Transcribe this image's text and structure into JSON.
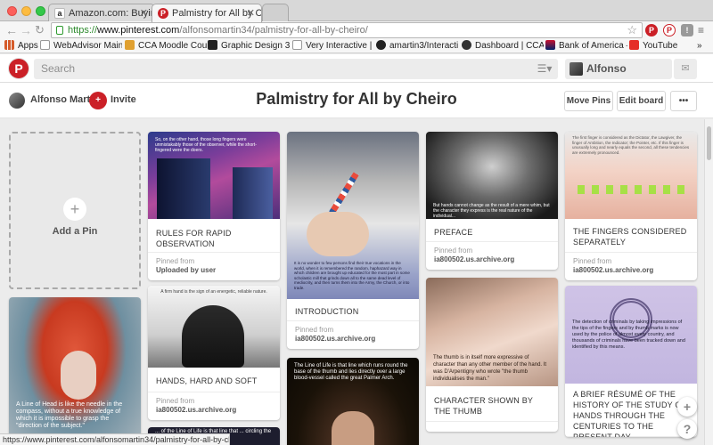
{
  "browser": {
    "tabs": [
      {
        "title": "Amazon.com: Buying Cho",
        "favicon": "a",
        "color": "#222222",
        "active": false
      },
      {
        "title": "Palmistry for All by Cheiro",
        "favicon": "P",
        "color": "#cb2027",
        "active": true
      }
    ],
    "url_scheme": "https://",
    "url_host": "www.pinterest.com",
    "url_path": "/alfonsomartin34/palmistry-for-all-by-cheiro/",
    "bookmarks": [
      {
        "label": "Apps",
        "icon": "apps-grid-icon",
        "color": "#d55c2b"
      },
      {
        "label": "WebAdvisor Main Me",
        "icon": "document-icon",
        "color": "#9a9a9a"
      },
      {
        "label": "CCA Moodle Courses",
        "icon": "moodle-icon",
        "color": "#e0a030"
      },
      {
        "label": "Graphic Design 3: In",
        "icon": "v-logo-icon",
        "color": "#222222"
      },
      {
        "label": "Very Interactive | Hou",
        "icon": "document-icon",
        "color": "#9a9a9a"
      },
      {
        "label": "amartin3/Interactive",
        "icon": "github-icon",
        "color": "#222222"
      },
      {
        "label": "Dashboard | CCA Va",
        "icon": "dashboard-icon",
        "color": "#333333"
      },
      {
        "label": "Bank of America —",
        "icon": "bank-icon",
        "color": "#c8102e"
      },
      {
        "label": "YouTube",
        "icon": "youtube-icon",
        "color": "#e52d27"
      }
    ]
  },
  "header": {
    "search_placeholder": "Search",
    "user_name": "Alfonso"
  },
  "board": {
    "owner": "Alfonso Martin",
    "invite_label": "Invite",
    "title": "Palmistry for All by Cheiro",
    "move_pins": "Move Pins",
    "edit_board": "Edit board",
    "more": "•••"
  },
  "add_pin_label": "Add a Pin",
  "pins": [
    {
      "id": "rules",
      "title": "RULES FOR RAPID OBSERVATION",
      "pinned_from": "Pinned from",
      "source": "Uploaded by user",
      "caption": "So, on the other hand, those long fingers were unmistakably those of the observer, while the short-fingered were the doers."
    },
    {
      "id": "introduction",
      "title": "INTRODUCTION",
      "pinned_from": "Pinned from",
      "source": "ia800502.us.archive.org",
      "caption": "It is no wonder to few persons find their true vocations in the world, when it is remembered the random, haphazard way in which children are brought up educated for the most part in some scholastic mill that grinds down all to the same dead level of mediocrity, and then turns them into the Army, the Church, or into trade."
    },
    {
      "id": "preface",
      "title": "PREFACE",
      "pinned_from": "Pinned from",
      "source": "ia800502.us.archive.org",
      "caption": "But hands cannot change as the result of a mere whim, but the character they express is the real nature of the individual..."
    },
    {
      "id": "fingers",
      "title": "THE FINGERS CONSIDERED SEPARATELY",
      "pinned_from": "Pinned from",
      "source": "ia800502.us.archive.org",
      "caption": "The first finger is considered as the Dictator, the Lawgiver, the finger of Ambition, the Indicator; the Pointer, etc. If this finger is unusually long and nearly equals the second, all these tendencies are extremely pronounced."
    },
    {
      "id": "head",
      "title": "",
      "caption": "A Line of Head is like the needle in the compass, without a true knowledge of which it is impossible to grasp the \"direction of the subject.\""
    },
    {
      "id": "handshard",
      "title": "HANDS, HARD AND SOFT",
      "pinned_from": "Pinned from",
      "source": "ia800502.us.archive.org",
      "caption": "A firm hand is the sign of an energetic, reliable nature."
    },
    {
      "id": "lifeline",
      "title": "",
      "caption": "The Line of Life is that line which runs round the base of the thumb and lies directly over a large blood-vessel called the great Palmer Arch."
    },
    {
      "id": "thumb",
      "title": "CHARACTER SHOWN BY THE THUMB",
      "caption": "The thumb is in itself more expressive of character than any other member of the hand. It was D'Arpentigny who wrote \"the thumb individualises the man.\""
    },
    {
      "id": "history",
      "title": "A BRIEF RÉSUMÉ OF THE HISTORY OF THE STUDY OF HANDS THROUGH THE CENTURIES TO THE PRESENT DAY",
      "caption": "The detection of criminals by taking impressions of the tips of the fingers and by thumb marks is now used by the police of almost every country, and thousands of criminals have been tracked down and identified by this means."
    },
    {
      "id": "bottom5",
      "title": "",
      "caption": "... of the Line of Life is that line that ... circling the ..."
    }
  ],
  "float": {
    "add": "+",
    "help": "?"
  },
  "status_url": "https://www.pinterest.com/alfonsomartin34/palmistry-for-all-by-cheiro/#"
}
